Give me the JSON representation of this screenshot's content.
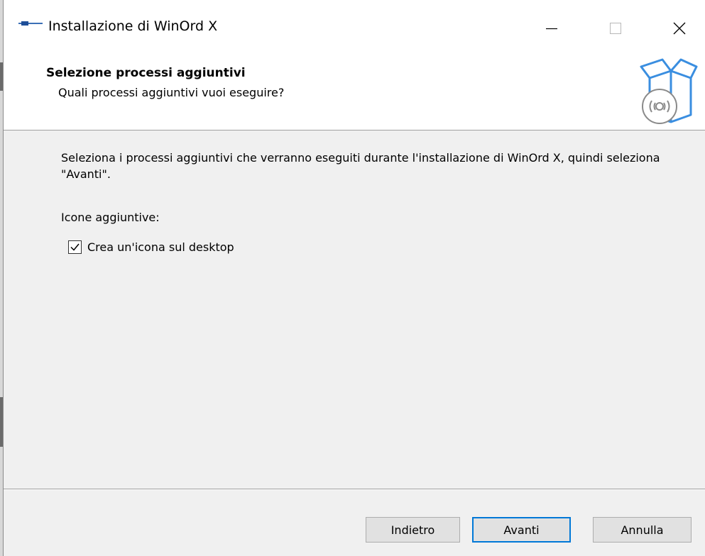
{
  "window": {
    "title": "Installazione di WinOrd X",
    "controls": {
      "minimize_icon": "minimize-icon",
      "maximize_icon": "maximize-icon",
      "close_icon": "close-icon"
    }
  },
  "header": {
    "title": "Selezione processi aggiuntivi",
    "subtitle": "Quali processi aggiuntivi vuoi eseguire?",
    "image_icon": "setup-box-icon"
  },
  "body": {
    "description": "Seleziona i processi aggiuntivi che verranno eseguiti durante l'installazione di WinOrd X, quindi seleziona \"Avanti\".",
    "group_label": "Icone aggiuntive:",
    "tasks": [
      {
        "label": "Crea un'icona sul desktop",
        "checked": true
      }
    ]
  },
  "footer": {
    "back_label": "Indietro",
    "next_label": "Avanti",
    "cancel_label": "Annulla"
  },
  "colors": {
    "accent": "#0078d7",
    "box_icon": "#3a8ee0",
    "window_bg": "#f0f0f0",
    "header_bg": "#ffffff"
  }
}
